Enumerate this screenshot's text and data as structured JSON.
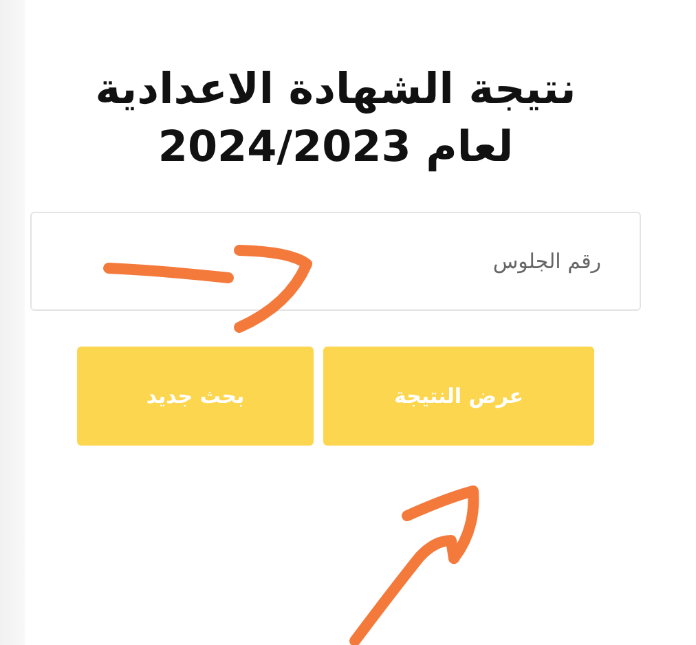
{
  "title_lines": [
    "نتيجة الشهادة الاعدادية",
    "لعام 2024/2023"
  ],
  "search": {
    "placeholder": "رقم الجلوس"
  },
  "buttons": [
    "عرض النتيجة",
    "بحث جديد"
  ]
}
